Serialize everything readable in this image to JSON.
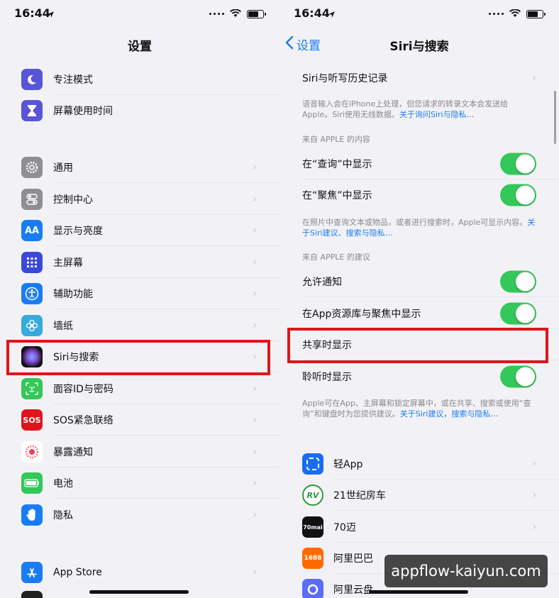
{
  "status": {
    "time": "16:44"
  },
  "left": {
    "title": "设置",
    "items": [
      {
        "label": "专注模式",
        "icon": "moon-icon",
        "color": "#5856d6"
      },
      {
        "label": "屏幕使用时间",
        "icon": "hourglass-icon",
        "color": "#5856d6"
      },
      {
        "label": "通用",
        "icon": "gear-icon",
        "color": "#8e8e93"
      },
      {
        "label": "控制中心",
        "icon": "switches-icon",
        "color": "#8e8e93"
      },
      {
        "label": "显示与亮度",
        "icon": "text-size-icon",
        "color": "#1a7cf5"
      },
      {
        "label": "主屏幕",
        "icon": "home-grid-icon",
        "color": "#3a4ad8"
      },
      {
        "label": "辅助功能",
        "icon": "accessibility-icon",
        "color": "#1a7cf5"
      },
      {
        "label": "墙纸",
        "icon": "flower-icon",
        "color": "#36aadc"
      },
      {
        "label": "Siri与搜索",
        "icon": "siri-icon",
        "color": "#222"
      },
      {
        "label": "面容ID与密码",
        "icon": "face-id-icon",
        "color": "#34c759"
      },
      {
        "label": "SOS紧急联络",
        "icon": "sos-icon",
        "color": "#e0141c",
        "icon_text": "SOS"
      },
      {
        "label": "暴露通知",
        "icon": "exposure-icon",
        "color": "#ffffff"
      },
      {
        "label": "电池",
        "icon": "battery-icon",
        "color": "#34c759"
      },
      {
        "label": "隐私",
        "icon": "hand-icon",
        "color": "#1a7cf5"
      },
      {
        "label": "App Store",
        "icon": "app-store-icon",
        "color": "#1a7cf5"
      }
    ]
  },
  "right": {
    "back_label": "设置",
    "title": "Siri与搜索",
    "history_row": "Siri与听写历史记录",
    "note1": "语音输入会在iPhone上处理，但您请求的转录文本会发送给Apple。Siri使用无线数据。",
    "note1_link": "关于询问Siri与隐私…",
    "section1": "来自 APPLE 的内容",
    "row_lookup": "在“查询”中显示",
    "row_spotlight": "在“聚焦”中显示",
    "note2": "在照片中查询文本或物品，或者进行搜索时，Apple可显示内容。",
    "note2_link": "关于Siri建议、搜索与隐私…",
    "section2": "来自 APPLE 的建议",
    "row_notify": "允许通知",
    "row_library": "在App资源库与聚焦中显示",
    "row_shareplay": "共享时显示",
    "row_listen": "聆听时显示",
    "note3": "Apple可在App、主屏幕和锁定屏幕中，或在共享、搜索或使用“查询”和键盘时为您提供建议。",
    "note3_link": "关于Siri建议，搜索与隐私…",
    "apps": [
      {
        "label": "轻App",
        "icon": "light-app-icon",
        "color": "#1a6cf0"
      },
      {
        "label": "21世纪房车",
        "icon": "rv21-icon",
        "color": "#ffffff",
        "icon_text": "RV"
      },
      {
        "label": "70迈",
        "icon": "70mai-icon",
        "color": "#111111",
        "icon_text": "70mai"
      },
      {
        "label": "阿里巴巴",
        "icon": "alibaba-icon",
        "color": "#ff6a00",
        "icon_text": "1688"
      },
      {
        "label": "阿里云盘",
        "icon": "aliyun-drive-icon",
        "color": "#5b6df8"
      }
    ]
  },
  "watermark": "appflow-kaiyun.com"
}
